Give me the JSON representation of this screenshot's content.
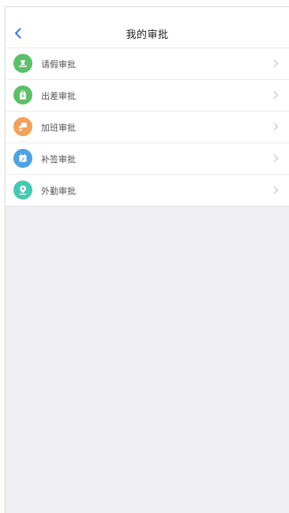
{
  "header": {
    "title": "我的审批"
  },
  "list": {
    "items": [
      {
        "label": "请假审批",
        "icon": "leave-icon",
        "color": "#5cbf6a"
      },
      {
        "label": "出差审批",
        "icon": "briefcase-icon",
        "color": "#5cbf6a"
      },
      {
        "label": "加班审批",
        "icon": "overtime-icon",
        "color": "#f2a25a"
      },
      {
        "label": "补签审批",
        "icon": "calendar-icon",
        "color": "#4fa3e3"
      },
      {
        "label": "外勤审批",
        "icon": "location-icon",
        "color": "#46c8b4"
      }
    ]
  }
}
